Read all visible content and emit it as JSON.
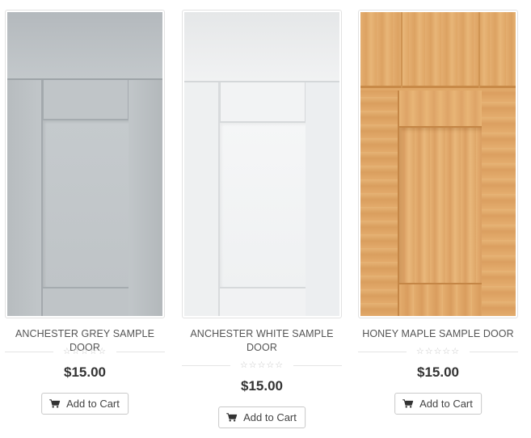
{
  "products": [
    {
      "name": "ANCHESTER GREY SAMPLE DOOR",
      "rating": "☆☆☆☆☆",
      "rating_value": 0,
      "rating_max": 5,
      "price": "$15.00",
      "cart_label": "Add to Cart",
      "icon": "shopping-cart-icon"
    },
    {
      "name": "ANCHESTER WHITE SAMPLE DOOR",
      "rating": "☆☆☆☆☆",
      "rating_value": 0,
      "rating_max": 5,
      "price": "$15.00",
      "cart_label": "Add to Cart",
      "icon": "shopping-cart-icon"
    },
    {
      "name": "HONEY MAPLE SAMPLE DOOR",
      "rating": "☆☆☆☆☆",
      "rating_value": 0,
      "rating_max": 5,
      "price": "$15.00",
      "cart_label": "Add to Cart",
      "icon": "shopping-cart-icon"
    }
  ],
  "colors": {
    "text": "#555555",
    "price": "#333333",
    "star_empty": "#c8c8c8",
    "border": "#c9c9c9"
  }
}
